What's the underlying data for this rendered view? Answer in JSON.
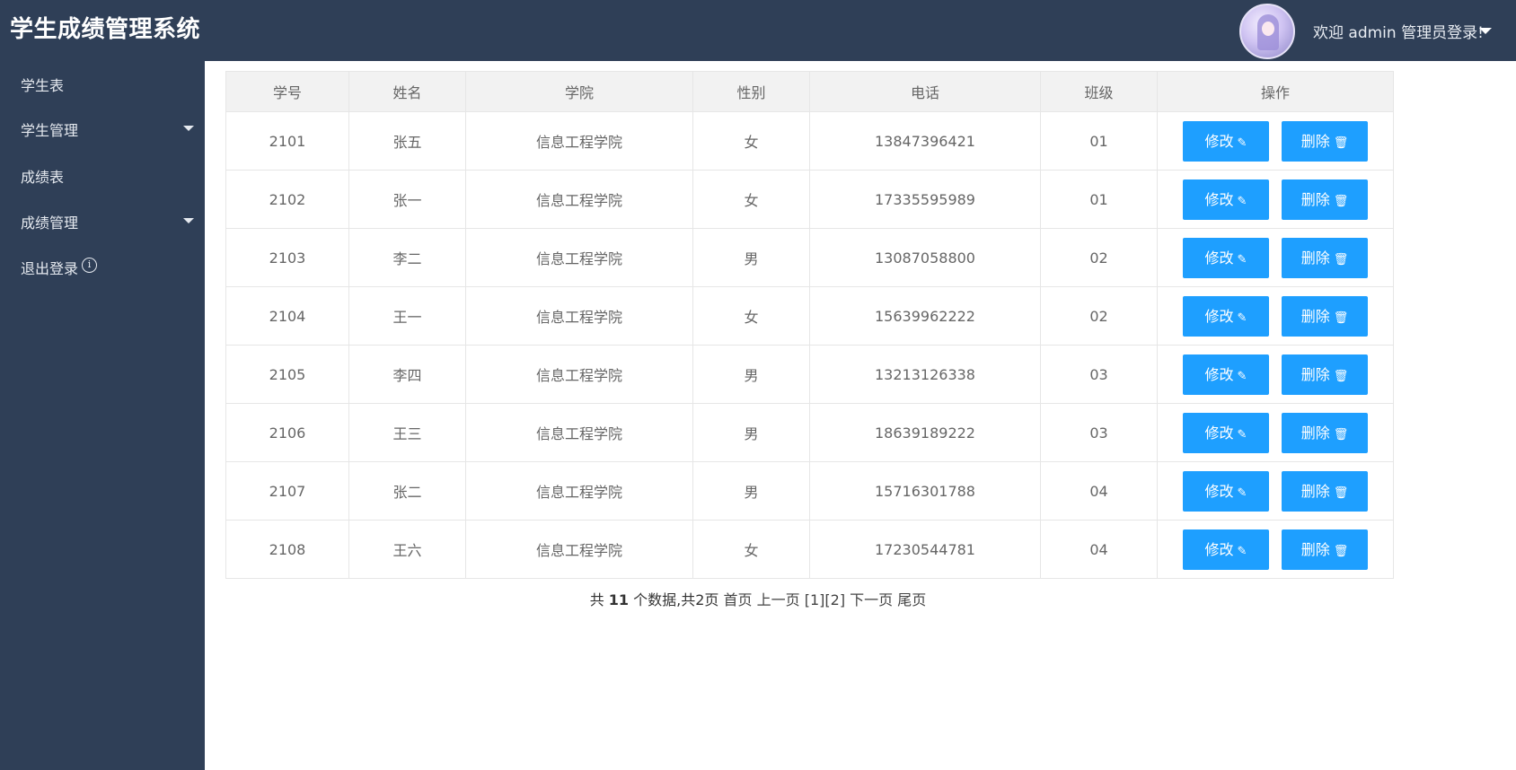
{
  "header": {
    "app_title": "学生成绩管理系统",
    "welcome_text": "欢迎 admin 管理员登录!",
    "avatar_alt": "admin avatar"
  },
  "sidebar": {
    "items": [
      {
        "label": "学生表",
        "has_submenu": false
      },
      {
        "label": "学生管理",
        "has_submenu": true
      },
      {
        "label": "成绩表",
        "has_submenu": false
      },
      {
        "label": "成绩管理",
        "has_submenu": true
      },
      {
        "label": "退出登录",
        "has_submenu": false,
        "icon": "info-icon"
      }
    ]
  },
  "table": {
    "columns": [
      "学号",
      "姓名",
      "学院",
      "性别",
      "电话",
      "班级",
      "操作"
    ],
    "rows": [
      [
        "2101",
        "张五",
        "信息工程学院",
        "女",
        "13847396421",
        "01"
      ],
      [
        "2102",
        "张一",
        "信息工程学院",
        "女",
        "17335595989",
        "01"
      ],
      [
        "2103",
        "李二",
        "信息工程学院",
        "男",
        "13087058800",
        "02"
      ],
      [
        "2104",
        "王一",
        "信息工程学院",
        "女",
        "15639962222",
        "02"
      ],
      [
        "2105",
        "李四",
        "信息工程学院",
        "男",
        "13213126338",
        "03"
      ],
      [
        "2106",
        "王三",
        "信息工程学院",
        "男",
        "18639189222",
        "03"
      ],
      [
        "2107",
        "张二",
        "信息工程学院",
        "男",
        "15716301788",
        "04"
      ],
      [
        "2108",
        "王六",
        "信息工程学院",
        "女",
        "17230544781",
        "04"
      ]
    ],
    "edit_label": "修改",
    "edit_icon": "edit-icon",
    "delete_label": "删除",
    "delete_icon": "trash-icon",
    "button_color": "#1e9fff"
  },
  "pagination": {
    "prefix": "共 ",
    "total": "11",
    "summary": " 个数据,共2页",
    "first": "首页",
    "prev": "上一页",
    "pages": "[1][2]",
    "next": "下一页",
    "last": "尾页"
  },
  "colors": {
    "sidebar_bg": "#2f3f57",
    "header_bg": "#2f3f57",
    "table_header_bg": "#f2f2f2"
  }
}
